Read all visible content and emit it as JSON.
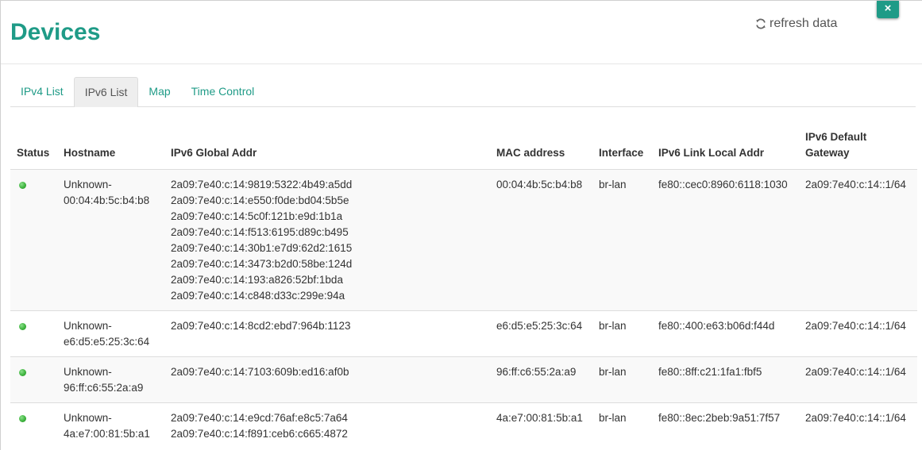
{
  "header": {
    "title": "Devices",
    "refresh_label": "refresh data",
    "close_label": "×"
  },
  "tabs": [
    {
      "label": "IPv4 List",
      "active": false
    },
    {
      "label": "IPv6 List",
      "active": true
    },
    {
      "label": "Map",
      "active": false
    },
    {
      "label": "Time Control",
      "active": false
    }
  ],
  "table": {
    "columns": [
      "Status",
      "Hostname",
      "IPv6 Global Addr",
      "MAC address",
      "Interface",
      "IPv6 Link Local Addr",
      "IPv6 Default Gateway"
    ],
    "rows": [
      {
        "status": "online",
        "hostname": "Unknown-\n00:04:4b:5c:b4:b8",
        "global_addrs": [
          "2a09:7e40:c:14:9819:5322:4b49:a5dd",
          "2a09:7e40:c:14:e550:f0de:bd04:5b5e",
          "2a09:7e40:c:14:5c0f:121b:e9d:1b1a",
          "2a09:7e40:c:14:f513:6195:d89c:b495",
          "2a09:7e40:c:14:30b1:e7d9:62d2:1615",
          "2a09:7e40:c:14:3473:b2d0:58be:124d",
          "2a09:7e40:c:14:193:a826:52bf:1bda",
          "2a09:7e40:c:14:c848:d33c:299e:94a"
        ],
        "mac": "00:04:4b:5c:b4:b8",
        "interface": "br-lan",
        "link_local": "fe80::cec0:8960:6118:1030",
        "gateway": "2a09:7e40:c:14::1/64"
      },
      {
        "status": "online",
        "hostname": "Unknown-\ne6:d5:e5:25:3c:64",
        "global_addrs": [
          "2a09:7e40:c:14:8cd2:ebd7:964b:1123"
        ],
        "mac": "e6:d5:e5:25:3c:64",
        "interface": "br-lan",
        "link_local": "fe80::400:e63:b06d:f44d",
        "gateway": "2a09:7e40:c:14::1/64"
      },
      {
        "status": "online",
        "hostname": "Unknown-\n96:ff:c6:55:2a:a9",
        "global_addrs": [
          "2a09:7e40:c:14:7103:609b:ed16:af0b"
        ],
        "mac": "96:ff:c6:55:2a:a9",
        "interface": "br-lan",
        "link_local": "fe80::8ff:c21:1fa1:fbf5",
        "gateway": "2a09:7e40:c:14::1/64"
      },
      {
        "status": "online",
        "hostname": "Unknown-\n4a:e7:00:81:5b:a1",
        "global_addrs": [
          "2a09:7e40:c:14:e9cd:76af:e8c5:7a64",
          "2a09:7e40:c:14:f891:ceb6:c665:4872"
        ],
        "mac": "4a:e7:00:81:5b:a1",
        "interface": "br-lan",
        "link_local": "fe80::8ec:2beb:9a51:7f57",
        "gateway": "2a09:7e40:c:14::1/64"
      }
    ]
  },
  "colors": {
    "accent": "#1f9b87",
    "status_online": "#3fb43f"
  },
  "icons": {
    "refresh": "refresh-icon",
    "close": "close-icon",
    "status": "status-dot-icon"
  }
}
